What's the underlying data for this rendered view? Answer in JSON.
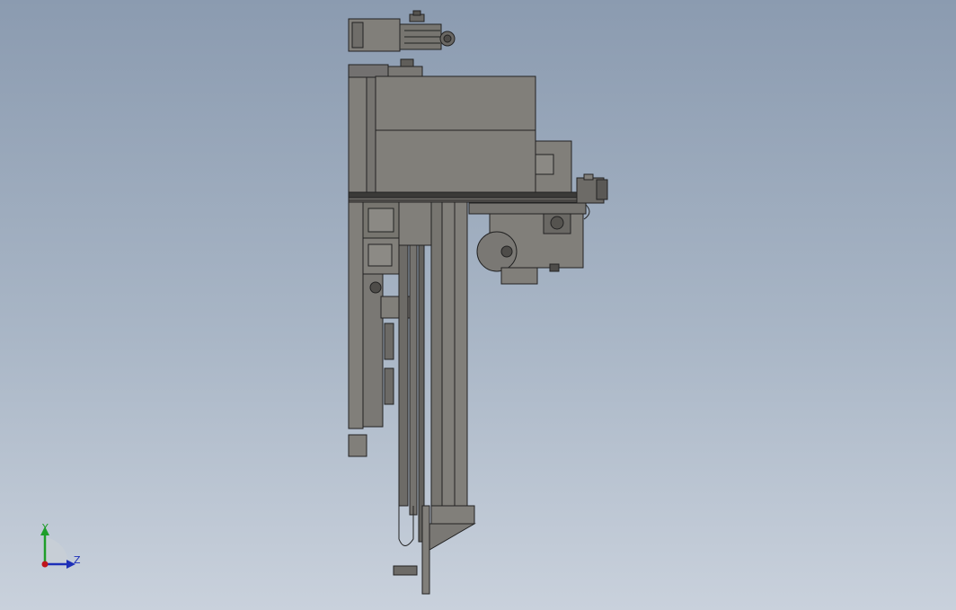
{
  "viewport": {
    "background_top": "#8b9bb0",
    "background_bottom": "#c9d1dc",
    "model_fill": "#817f7a",
    "model_line": "#222222"
  },
  "triad": {
    "y_label": "Y",
    "z_label": "Z",
    "y_color": "#1f9e2a",
    "z_color": "#1d2fb8",
    "x_color": "#c0141b",
    "icons": [
      "y-axis-arrow-icon",
      "z-axis-arrow-icon",
      "x-axis-origin-icon"
    ]
  }
}
